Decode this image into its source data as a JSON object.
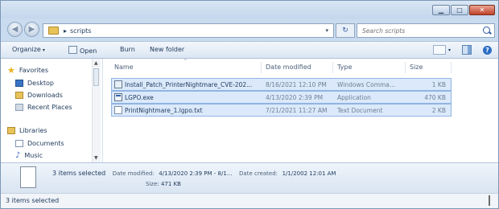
{
  "address": {
    "breadcrumb_sep": "▸",
    "folder": "scripts",
    "dropdown": "▾",
    "refresh_glyph": "↻"
  },
  "search": {
    "placeholder": "Search scripts"
  },
  "toolbar": {
    "organize": "Organize",
    "open": "Open",
    "burn": "Burn",
    "new_folder": "New folder",
    "caret": "▾"
  },
  "nav": {
    "favorites": "Favorites",
    "desktop": "Desktop",
    "downloads": "Downloads",
    "recent_places": "Recent Places",
    "libraries": "Libraries",
    "documents": "Documents",
    "music": "Music"
  },
  "columns": {
    "name": "Name",
    "date_modified": "Date modified",
    "type": "Type",
    "size": "Size"
  },
  "files": [
    {
      "name": "Install_Patch_PrinterNightmare_CVE-202...",
      "date": "8/16/2021 12:10 PM",
      "type": "Windows Comma...",
      "size": "1 KB",
      "icon": "cmd-file-icon"
    },
    {
      "name": "LGPO.exe",
      "date": "4/13/2020 2:39 PM",
      "type": "Application",
      "size": "470 KB",
      "icon": "exe-file-icon"
    },
    {
      "name": "PrintNightmare_1.lgpo.txt",
      "date": "7/21/2021 11:27 AM",
      "type": "Text Document",
      "size": "2 KB",
      "icon": "txt-file-icon"
    }
  ],
  "details": {
    "selected": "3 items selected",
    "date_modified_label": "Date modified:",
    "date_modified_value": "4/13/2020 2:39 PM - 8/1...",
    "date_created_label": "Date created:",
    "date_created_value": "1/1/2002 12:01 AM",
    "size_label": "Size:",
    "size_value": "471 KB"
  },
  "status": {
    "text": "3 items selected"
  },
  "colors": {
    "selection_fill": "#dbe9fb",
    "selection_border": "#90b5e3",
    "chrome": "#c9dbee"
  }
}
